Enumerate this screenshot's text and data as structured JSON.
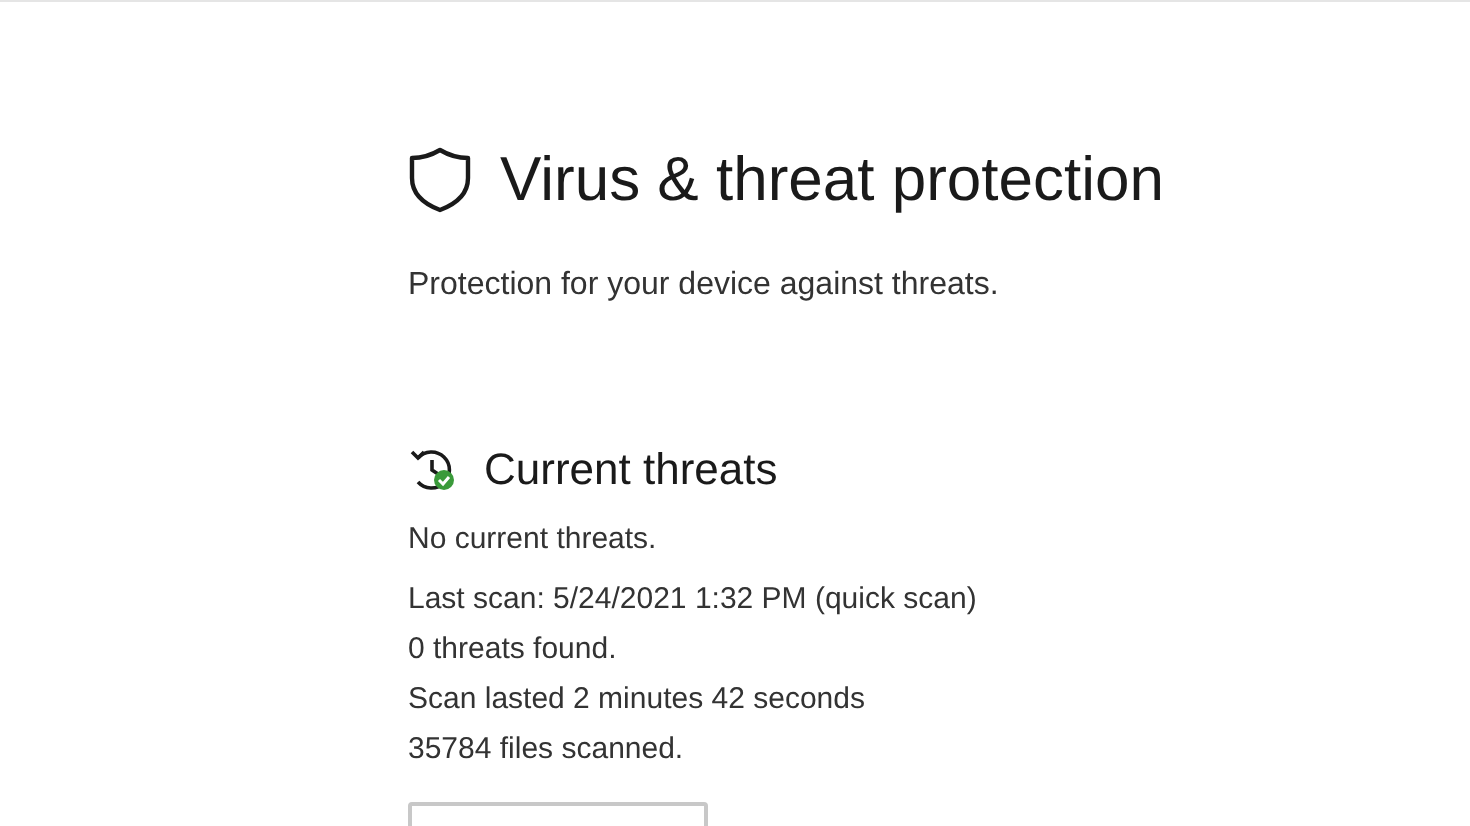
{
  "page": {
    "title": "Virus & threat protection",
    "subtitle": "Protection for your device against threats."
  },
  "current_threats": {
    "heading": "Current threats",
    "status": "No current threats.",
    "details": [
      "Last scan: 5/24/2021 1:32 PM (quick scan)",
      "0 threats found.",
      "Scan lasted 2 minutes 42 seconds",
      "35784 files scanned."
    ]
  }
}
